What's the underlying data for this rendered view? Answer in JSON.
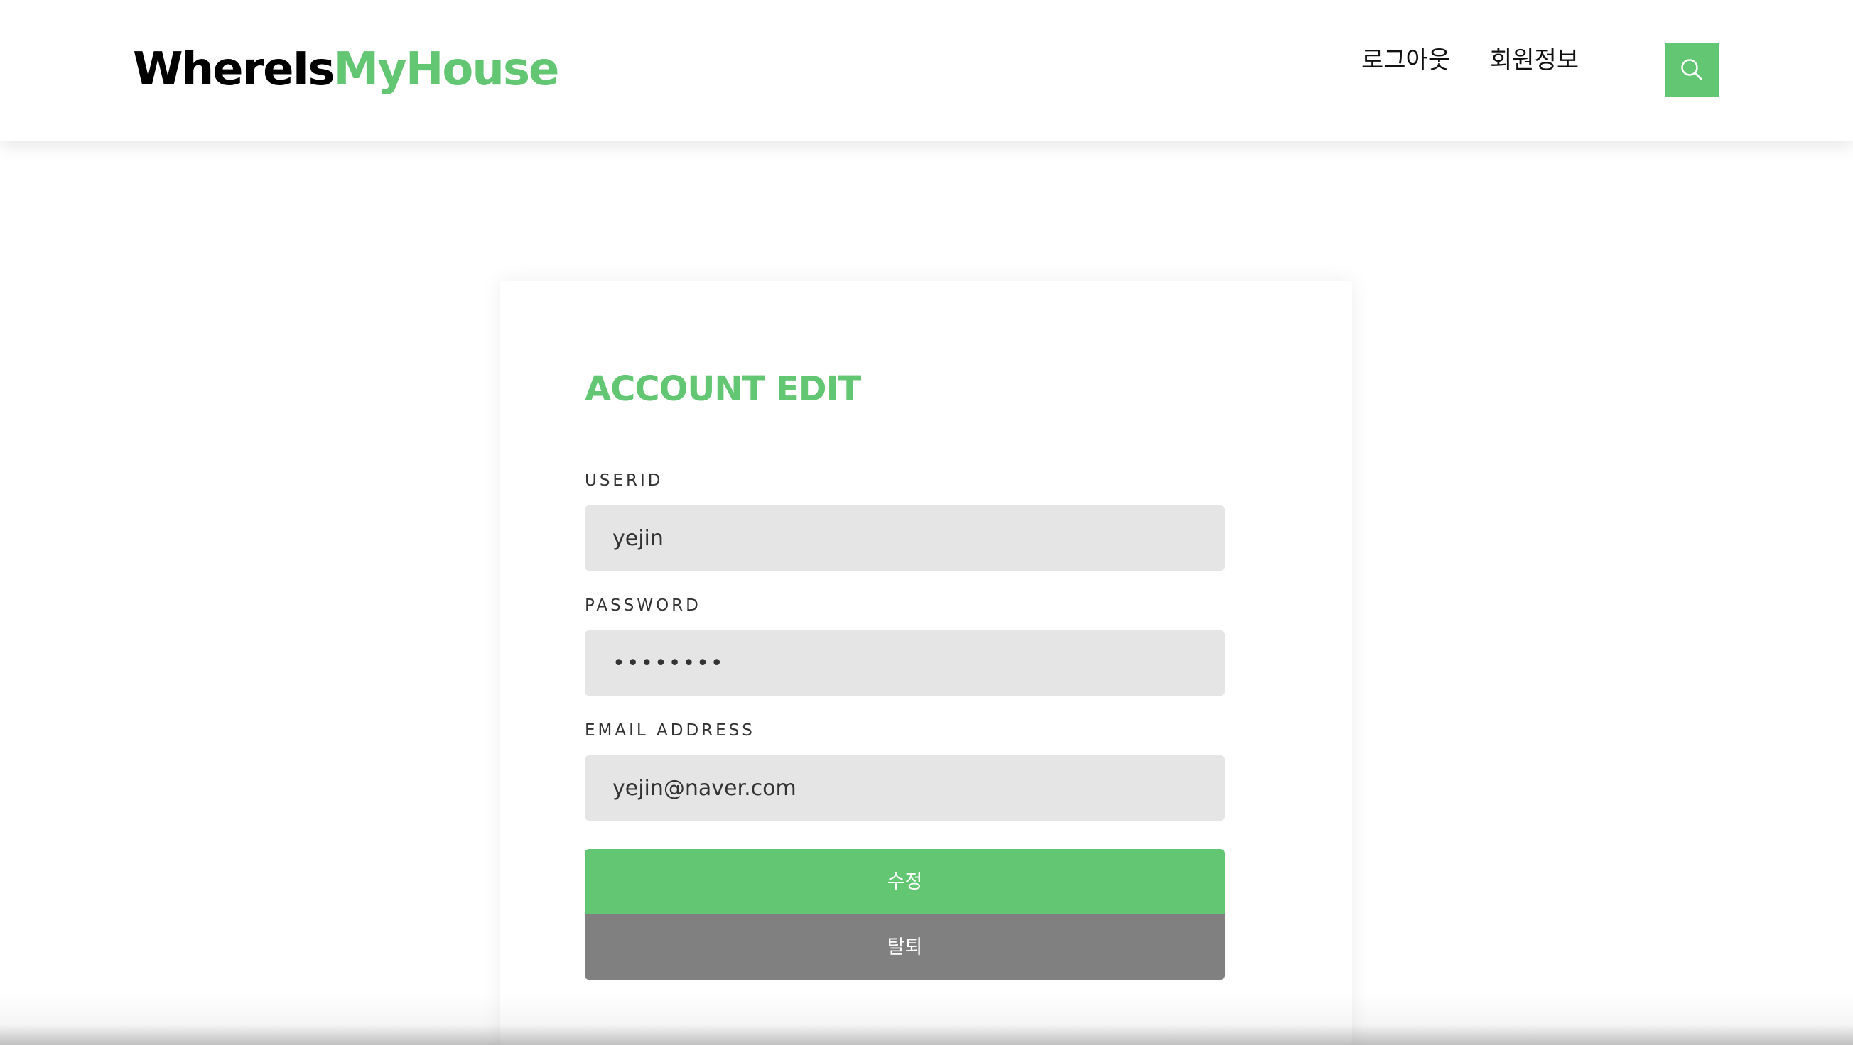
{
  "navbar": {
    "brand_part1": "WhereIs",
    "brand_part2": "MyHouse",
    "links": [
      {
        "label": "로그아웃"
      },
      {
        "label": "회원정보"
      }
    ],
    "search_icon": "search-icon"
  },
  "form": {
    "title": "ACCOUNT EDIT",
    "userid": {
      "label": "USERID",
      "value": "yejin"
    },
    "password": {
      "label": "PASSWORD",
      "value": "••••••••"
    },
    "email": {
      "label": "EMAIL ADDRESS",
      "value": "yejin@naver.com"
    },
    "edit_button": "수정",
    "withdraw_button": "탈퇴"
  },
  "colors": {
    "accent": "#63c672",
    "input_bg": "#e5e5e5",
    "secondary_button": "#808080"
  }
}
